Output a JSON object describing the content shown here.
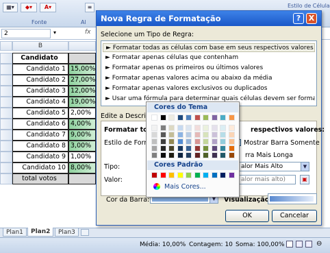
{
  "ribbon": {
    "font_group": "Fonte",
    "align_group": "Al",
    "style_hint": "Estilo de Célula"
  },
  "namebox": "2",
  "formula_fx": "fx",
  "grid": {
    "col_b": "B",
    "header": "Candidato",
    "rows": [
      {
        "name": "Candidato 1",
        "value": "15,00%",
        "green": true
      },
      {
        "name": "Candidato 2",
        "value": "27,00%",
        "green": true
      },
      {
        "name": "Candidato 3",
        "value": "12,00%",
        "green": true
      },
      {
        "name": "Candidato 4",
        "value": "19,00%",
        "green": true
      },
      {
        "name": "Candidato 5",
        "value": "2,00%",
        "green": false
      },
      {
        "name": "Candidato 6",
        "value": "4,00%",
        "green": true
      },
      {
        "name": "Candidato 7",
        "value": "9,00%",
        "green": true
      },
      {
        "name": "Candidato 8",
        "value": "3,00%",
        "green": true
      },
      {
        "name": "Candidato 9",
        "value": "1,00%",
        "green": false
      },
      {
        "name": "Candidato 10",
        "value": "8,00%",
        "green": true
      }
    ],
    "total": "total votos"
  },
  "sheets": [
    "Plan1",
    "Plan2",
    "Plan3"
  ],
  "status": {
    "media": "Média: 10,00%",
    "contagem": "Contagem: 10",
    "soma": "Soma: 100,00%"
  },
  "dialog": {
    "title": "Nova Regra de Formatação",
    "help": "?",
    "close": "X",
    "select_label": "Selecione um Tipo de Regra:",
    "rules": [
      "► Formatar todas as células com base em seus respectivos valores",
      "► Formatar apenas células que contenham",
      "► Formatar apenas os primeiros ou últimos valores",
      "► Formatar apenas valores acima ou abaixo da média",
      "► Formatar apenas valores exclusivos ou duplicados",
      "► Usar uma fórmula para determinar quais células devem ser formatadas"
    ],
    "edit_label": "Edite a Descrição",
    "format_all_left": "Formatar tod",
    "format_all_right": "respectivos valores:",
    "style_label": "Estilo de Format",
    "show_bar_only": "Mostrar Barra Somente",
    "longest_bar": "rra Mais Longa",
    "type_label": "Tipo:",
    "type_value": "alor Mais Alto",
    "value_label": "Valor:",
    "value_value": "alor mais alto)",
    "bar_color_label": "Cor da Barra:",
    "preview_label": "Visualização:",
    "ok": "OK",
    "cancel": "Cancelar"
  },
  "palette": {
    "theme_title": "Cores do Tema",
    "standard_title": "Cores Padrão",
    "more_colors": "Mais Cores...",
    "theme_top": [
      "#ffffff",
      "#000000",
      "#eeece1",
      "#1f497d",
      "#4f81bd",
      "#c0504d",
      "#9bbb59",
      "#8064a2",
      "#4bacc6",
      "#f79646"
    ],
    "theme_shades": [
      [
        "#f2f2f2",
        "#7f7f7f",
        "#ddd9c3",
        "#c6d9f0",
        "#dbe5f1",
        "#f2dcdb",
        "#ebf1dd",
        "#e5e0ec",
        "#dbeef3",
        "#fdeada"
      ],
      [
        "#d8d8d8",
        "#595959",
        "#c4bd97",
        "#8db3e2",
        "#b8cce4",
        "#e5b9b7",
        "#d7e3bc",
        "#ccc1d9",
        "#b7dde8",
        "#fbd5b5"
      ],
      [
        "#bfbfbf",
        "#3f3f3f",
        "#938953",
        "#548dd4",
        "#95b3d7",
        "#d99694",
        "#c3d69b",
        "#b2a2c7",
        "#92cddc",
        "#fac08f"
      ],
      [
        "#a5a5a5",
        "#262626",
        "#494429",
        "#17365d",
        "#366092",
        "#953734",
        "#76923c",
        "#5f497a",
        "#31859b",
        "#e36c09"
      ],
      [
        "#7f7f7f",
        "#0c0c0c",
        "#1d1b10",
        "#0f243e",
        "#244061",
        "#632423",
        "#4f6128",
        "#3f3151",
        "#205867",
        "#974806"
      ]
    ],
    "standard": [
      "#c00000",
      "#ff0000",
      "#ffc000",
      "#ffff00",
      "#92d050",
      "#00b050",
      "#00b0f0",
      "#0070c0",
      "#002060",
      "#7030a0"
    ],
    "selected_bar_color": "#7fa6d8"
  }
}
